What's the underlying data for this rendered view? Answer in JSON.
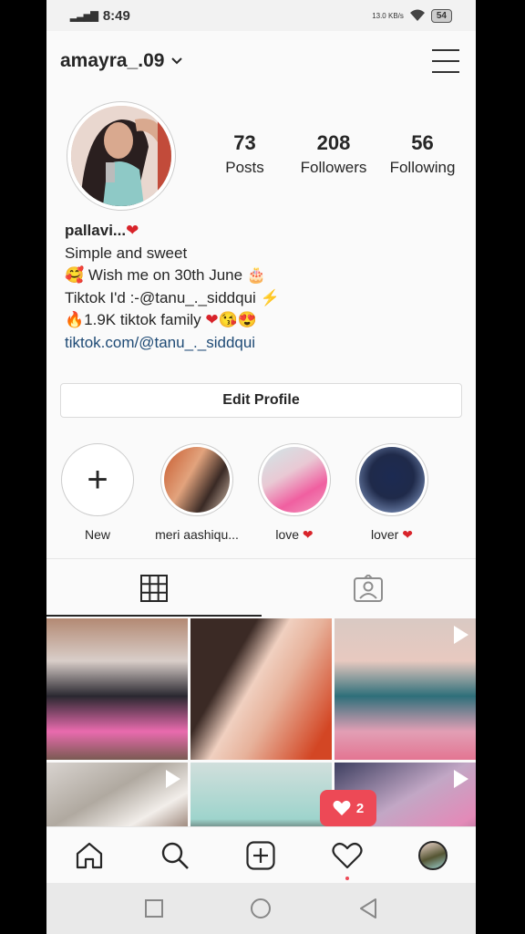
{
  "status_bar": {
    "time": "8:49",
    "network": "13.0 KB/s",
    "battery": "54"
  },
  "header": {
    "username": "amayra_.09"
  },
  "profile": {
    "stats": [
      {
        "value": "73",
        "label": "Posts"
      },
      {
        "value": "208",
        "label": "Followers"
      },
      {
        "value": "56",
        "label": "Following"
      }
    ],
    "bio": {
      "name": "pallavi...",
      "line1": "Simple and sweet",
      "line2": "Wish me on 30th June",
      "line3": "Tiktok I'd :-@tanu_._siddqui",
      "line4": "1.9K tiktok family",
      "link": "tiktok.com/@tanu_._siddqui"
    },
    "edit_button": "Edit Profile"
  },
  "highlights": [
    {
      "label": "New"
    },
    {
      "label": "meri aashiqu..."
    },
    {
      "label": "love"
    },
    {
      "label": "lover"
    }
  ],
  "notification": {
    "count": "2"
  },
  "icons": {
    "heart": "heart-icon",
    "grid": "grid-icon",
    "tagged": "tagged-icon",
    "home": "home-icon",
    "search": "search-icon",
    "add": "add-post-icon",
    "activity": "activity-heart-icon"
  },
  "colors": {
    "accent_red": "#ed4956",
    "link_blue": "#1e4a75"
  }
}
